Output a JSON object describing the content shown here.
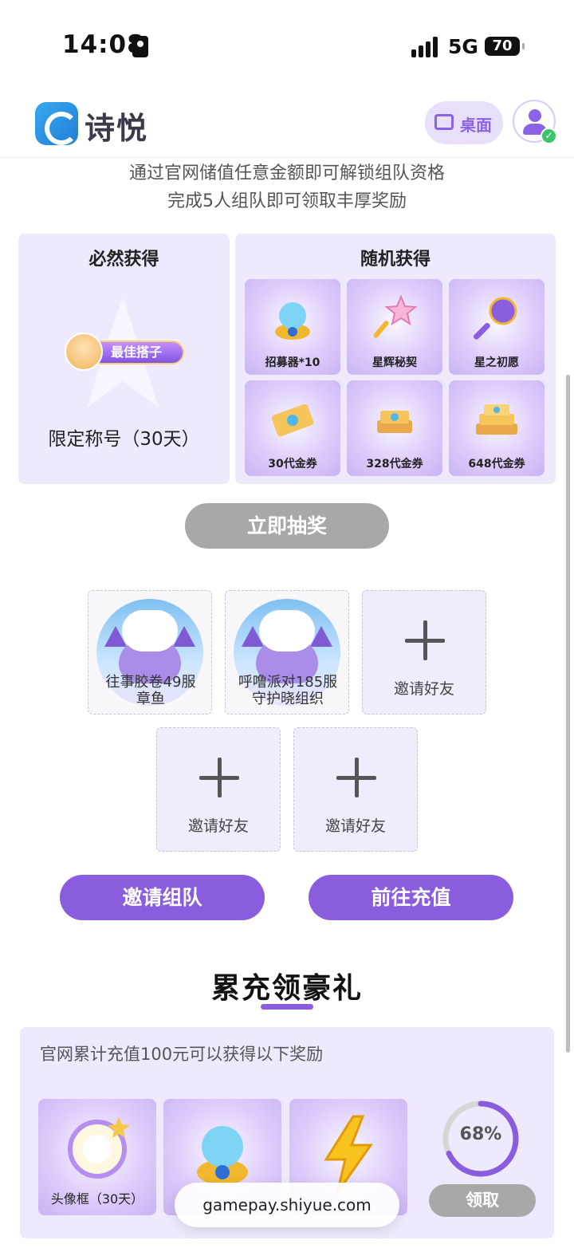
{
  "status_bar": {
    "time": "14:08",
    "network": "5G",
    "battery": "70"
  },
  "header": {
    "logo_text": "诗悦",
    "desktop_label": "桌面"
  },
  "intro": {
    "line1": "通过官网储值任意金额即可解锁组队资格",
    "line2": "完成5人组队即可领取丰厚奖励"
  },
  "rewards": {
    "guaranteed": {
      "title": "必然获得",
      "badge_text": "最佳搭子",
      "label": "限定称号（30天）"
    },
    "random": {
      "title": "随机获得",
      "items": [
        {
          "label": "招募器*10",
          "icon": "recruiter-icon"
        },
        {
          "label": "星辉秘契",
          "icon": "star-key-icon"
        },
        {
          "label": "星之初愿",
          "icon": "purple-key-icon"
        },
        {
          "label": "30代金券",
          "icon": "voucher-icon"
        },
        {
          "label": "328代金券",
          "icon": "voucher-stack-icon"
        },
        {
          "label": "648代金券",
          "icon": "voucher-pile-icon"
        }
      ]
    },
    "draw_button": "立即抽奖"
  },
  "team": {
    "members": [
      {
        "name_line1": "往事胶卷49服",
        "name_line2": "章鱼"
      },
      {
        "name_line1": "呼噜派对185服",
        "name_line2": "守护晓组织"
      }
    ],
    "invite_label": "邀请好友",
    "invite_team_button": "邀请组队",
    "recharge_button": "前往充值"
  },
  "cumulative": {
    "title": "累充领豪礼",
    "description": "官网累计充值100元可以获得以下奖励",
    "items": [
      {
        "label": "头像框（30天）",
        "icon": "avatar-frame-icon"
      },
      {
        "label": "",
        "icon": "recruiter-icon"
      },
      {
        "label": "",
        "icon": "lightning-icon"
      }
    ],
    "progress": 0.68,
    "progress_label": "68%",
    "claim_button": "领取"
  },
  "browser": {
    "url": "gamepay.shiyue.com"
  },
  "colors": {
    "accent": "#8a5ddf",
    "panel": "#efe9fd",
    "disabled": "#a8a8a8"
  }
}
